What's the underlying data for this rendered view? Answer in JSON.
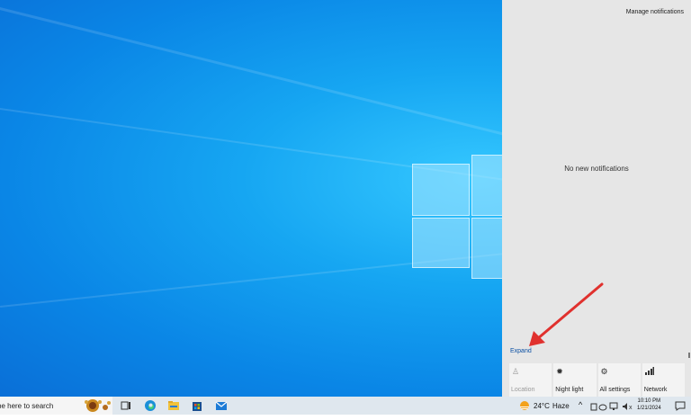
{
  "action_center": {
    "manage_label": "Manage notifications",
    "empty_label": "No new notifications",
    "expand_label": "Expand",
    "tiles": [
      {
        "label": "Location",
        "icon": "location-icon"
      },
      {
        "label": "Night light",
        "icon": "brightness-icon"
      },
      {
        "label": "All settings",
        "icon": "gear-icon"
      },
      {
        "label": "Network",
        "icon": "network-icon"
      }
    ]
  },
  "taskbar": {
    "search_placeholder": "pe here to search",
    "weather_temp": "24°C",
    "weather_desc": "Haze",
    "time": "10:10 PM",
    "date": "1/21/2024"
  },
  "colors": {
    "accent": "#0b4fa3",
    "arrow": "#e0312e",
    "panel": "#e6e6e6"
  }
}
